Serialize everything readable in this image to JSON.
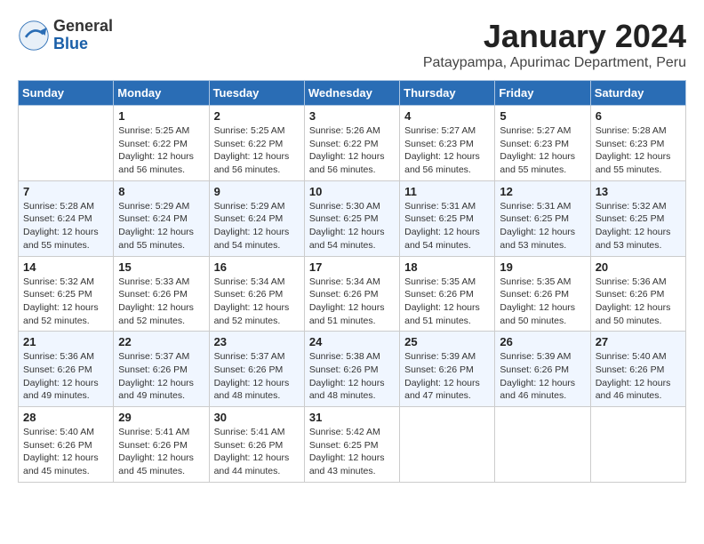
{
  "logo": {
    "general": "General",
    "blue": "Blue"
  },
  "title": "January 2024",
  "location": "Pataypampa, Apurimac Department, Peru",
  "days_of_week": [
    "Sunday",
    "Monday",
    "Tuesday",
    "Wednesday",
    "Thursday",
    "Friday",
    "Saturday"
  ],
  "weeks": [
    [
      {
        "day": "",
        "info": ""
      },
      {
        "day": "1",
        "info": "Sunrise: 5:25 AM\nSunset: 6:22 PM\nDaylight: 12 hours\nand 56 minutes."
      },
      {
        "day": "2",
        "info": "Sunrise: 5:25 AM\nSunset: 6:22 PM\nDaylight: 12 hours\nand 56 minutes."
      },
      {
        "day": "3",
        "info": "Sunrise: 5:26 AM\nSunset: 6:22 PM\nDaylight: 12 hours\nand 56 minutes."
      },
      {
        "day": "4",
        "info": "Sunrise: 5:27 AM\nSunset: 6:23 PM\nDaylight: 12 hours\nand 56 minutes."
      },
      {
        "day": "5",
        "info": "Sunrise: 5:27 AM\nSunset: 6:23 PM\nDaylight: 12 hours\nand 55 minutes."
      },
      {
        "day": "6",
        "info": "Sunrise: 5:28 AM\nSunset: 6:23 PM\nDaylight: 12 hours\nand 55 minutes."
      }
    ],
    [
      {
        "day": "7",
        "info": "Sunrise: 5:28 AM\nSunset: 6:24 PM\nDaylight: 12 hours\nand 55 minutes."
      },
      {
        "day": "8",
        "info": "Sunrise: 5:29 AM\nSunset: 6:24 PM\nDaylight: 12 hours\nand 55 minutes."
      },
      {
        "day": "9",
        "info": "Sunrise: 5:29 AM\nSunset: 6:24 PM\nDaylight: 12 hours\nand 54 minutes."
      },
      {
        "day": "10",
        "info": "Sunrise: 5:30 AM\nSunset: 6:25 PM\nDaylight: 12 hours\nand 54 minutes."
      },
      {
        "day": "11",
        "info": "Sunrise: 5:31 AM\nSunset: 6:25 PM\nDaylight: 12 hours\nand 54 minutes."
      },
      {
        "day": "12",
        "info": "Sunrise: 5:31 AM\nSunset: 6:25 PM\nDaylight: 12 hours\nand 53 minutes."
      },
      {
        "day": "13",
        "info": "Sunrise: 5:32 AM\nSunset: 6:25 PM\nDaylight: 12 hours\nand 53 minutes."
      }
    ],
    [
      {
        "day": "14",
        "info": "Sunrise: 5:32 AM\nSunset: 6:25 PM\nDaylight: 12 hours\nand 52 minutes."
      },
      {
        "day": "15",
        "info": "Sunrise: 5:33 AM\nSunset: 6:26 PM\nDaylight: 12 hours\nand 52 minutes."
      },
      {
        "day": "16",
        "info": "Sunrise: 5:34 AM\nSunset: 6:26 PM\nDaylight: 12 hours\nand 52 minutes."
      },
      {
        "day": "17",
        "info": "Sunrise: 5:34 AM\nSunset: 6:26 PM\nDaylight: 12 hours\nand 51 minutes."
      },
      {
        "day": "18",
        "info": "Sunrise: 5:35 AM\nSunset: 6:26 PM\nDaylight: 12 hours\nand 51 minutes."
      },
      {
        "day": "19",
        "info": "Sunrise: 5:35 AM\nSunset: 6:26 PM\nDaylight: 12 hours\nand 50 minutes."
      },
      {
        "day": "20",
        "info": "Sunrise: 5:36 AM\nSunset: 6:26 PM\nDaylight: 12 hours\nand 50 minutes."
      }
    ],
    [
      {
        "day": "21",
        "info": "Sunrise: 5:36 AM\nSunset: 6:26 PM\nDaylight: 12 hours\nand 49 minutes."
      },
      {
        "day": "22",
        "info": "Sunrise: 5:37 AM\nSunset: 6:26 PM\nDaylight: 12 hours\nand 49 minutes."
      },
      {
        "day": "23",
        "info": "Sunrise: 5:37 AM\nSunset: 6:26 PM\nDaylight: 12 hours\nand 48 minutes."
      },
      {
        "day": "24",
        "info": "Sunrise: 5:38 AM\nSunset: 6:26 PM\nDaylight: 12 hours\nand 48 minutes."
      },
      {
        "day": "25",
        "info": "Sunrise: 5:39 AM\nSunset: 6:26 PM\nDaylight: 12 hours\nand 47 minutes."
      },
      {
        "day": "26",
        "info": "Sunrise: 5:39 AM\nSunset: 6:26 PM\nDaylight: 12 hours\nand 46 minutes."
      },
      {
        "day": "27",
        "info": "Sunrise: 5:40 AM\nSunset: 6:26 PM\nDaylight: 12 hours\nand 46 minutes."
      }
    ],
    [
      {
        "day": "28",
        "info": "Sunrise: 5:40 AM\nSunset: 6:26 PM\nDaylight: 12 hours\nand 45 minutes."
      },
      {
        "day": "29",
        "info": "Sunrise: 5:41 AM\nSunset: 6:26 PM\nDaylight: 12 hours\nand 45 minutes."
      },
      {
        "day": "30",
        "info": "Sunrise: 5:41 AM\nSunset: 6:26 PM\nDaylight: 12 hours\nand 44 minutes."
      },
      {
        "day": "31",
        "info": "Sunrise: 5:42 AM\nSunset: 6:25 PM\nDaylight: 12 hours\nand 43 minutes."
      },
      {
        "day": "",
        "info": ""
      },
      {
        "day": "",
        "info": ""
      },
      {
        "day": "",
        "info": ""
      }
    ]
  ]
}
